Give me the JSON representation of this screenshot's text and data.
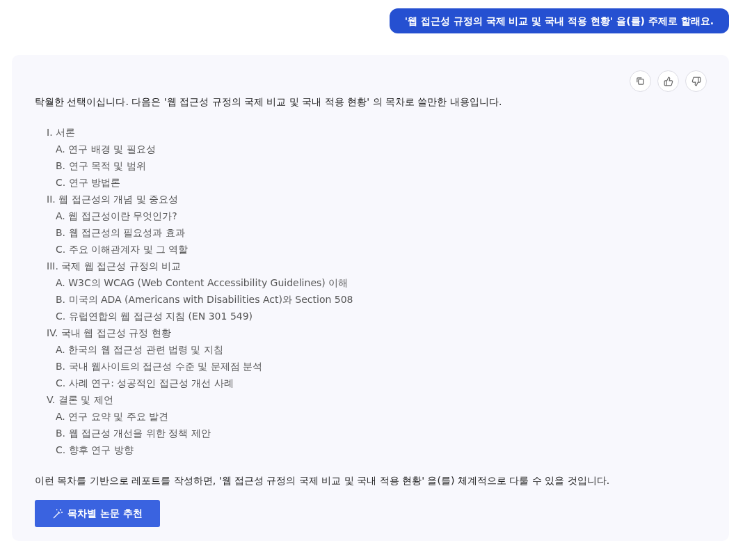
{
  "user_message": "'웹 접근성 규정의 국제 비교 및 국내 적용 현황' 을(를) 주제로 할래요.",
  "response": {
    "intro": "탁월한 선택이십니다. 다음은 '웹 접근성 규정의 국제 비교 및 국내 적용 현황' 의 목차로 쓸만한 내용입니다.",
    "outline": [
      {
        "label": "I. 서론",
        "children": [
          {
            "label": "A. 연구 배경 및 필요성"
          },
          {
            "label": "B. 연구 목적 및 범위"
          },
          {
            "label": "C. 연구 방법론"
          }
        ]
      },
      {
        "label": "II. 웹 접근성의 개념 및 중요성",
        "children": [
          {
            "label": "A. 웹 접근성이란 무엇인가?"
          },
          {
            "label": "B. 웹 접근성의 필요성과 효과"
          },
          {
            "label": "C. 주요 이해관계자 및 그 역할"
          }
        ]
      },
      {
        "label": "III. 국제 웹 접근성 규정의 비교",
        "children": [
          {
            "label": "A. W3C의 WCAG (Web Content Accessibility Guidelines) 이해"
          },
          {
            "label": "B. 미국의 ADA (Americans with Disabilities Act)와 Section 508"
          },
          {
            "label": "C. 유럽연합의 웹 접근성 지침 (EN 301 549)"
          }
        ]
      },
      {
        "label": "IV. 국내 웹 접근성 규정 현황",
        "children": [
          {
            "label": "A. 한국의 웹 접근성 관련 법령 및 지침"
          },
          {
            "label": "B. 국내 웹사이트의 접근성 수준 및 문제점 분석"
          },
          {
            "label": "C. 사례 연구: 성공적인 접근성 개선 사례"
          }
        ]
      },
      {
        "label": "V. 결론 및 제언",
        "children": [
          {
            "label": "A. 연구 요약 및 주요 발견"
          },
          {
            "label": "B. 웹 접근성 개선을 위한 정책 제안"
          },
          {
            "label": "C. 향후 연구 방향"
          }
        ]
      }
    ],
    "conclusion": "이런 목차를 기반으로 레포트를 작성하면, '웹 접근성 규정의 국제 비교 및 국내 적용 현황' 을(를) 체계적으로 다룰 수 있을 것입니다.",
    "action_button": "목차별 논문 추천"
  }
}
